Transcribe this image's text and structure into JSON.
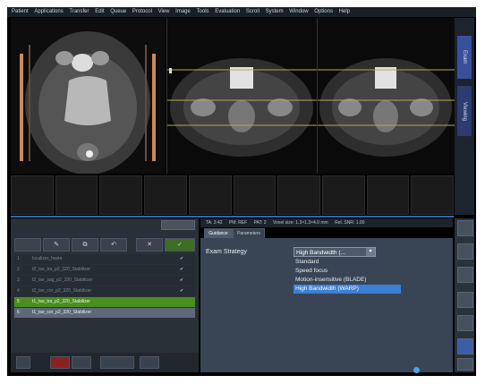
{
  "menu": [
    "Patient",
    "Applications",
    "Transfer",
    "Edit",
    "Queue",
    "Protocol",
    "View",
    "Image",
    "Tools",
    "Evaluation",
    "Scroll",
    "System",
    "Window",
    "Options",
    "Help"
  ],
  "right_tabs": [
    "Exam",
    "Viewing"
  ],
  "left_panel": {
    "tool_buttons": [
      "",
      "",
      "",
      "",
      "",
      ""
    ],
    "row_buttons": [
      "",
      "",
      "",
      "",
      "",
      ""
    ],
    "queue_rows": [
      {
        "num": "1",
        "title": "localizer_haste",
        "time": "",
        "check": "✔"
      },
      {
        "num": "2",
        "title": "t2_tse_tra_p2_320_Stabilizer",
        "time": "",
        "check": "✔"
      },
      {
        "num": "3",
        "title": "t2_tse_sag_p2_320_Stabilizer",
        "time": "",
        "check": "✔"
      },
      {
        "num": "4",
        "title": "t2_tse_cor_p2_320_Stabilizer",
        "time": "",
        "check": "✔"
      },
      {
        "num": "5",
        "title": "t1_tse_tra_p2_320_Stabilizer",
        "time": "",
        "check": ""
      },
      {
        "num": "6",
        "title": "t1_tse_cor_p2_320_Stabilizer",
        "time": "",
        "check": ""
      }
    ],
    "bottom_time": ""
  },
  "param_header": [
    "TA: 3:42",
    "PM: REF",
    "PAT: 2",
    "Voxel size: 1.3×1.3×4.0 mm",
    "Rel. SNR: 1.00"
  ],
  "param_tabs": [
    "Guidance",
    "Parameters"
  ],
  "exam_strategy": {
    "label": "Exam Strategy",
    "selected": "High Bandwidth (...",
    "options": [
      "Standard",
      "Speed focus",
      "Motion-insensitive (BLADE)",
      "High Bandwidth (WARP)"
    ],
    "highlighted_index": 3
  }
}
